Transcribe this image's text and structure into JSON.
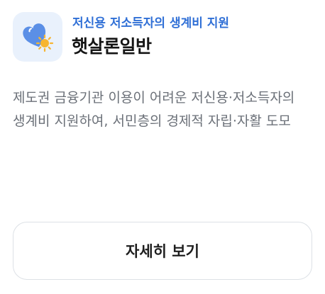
{
  "card": {
    "icon": "heart-with-sun-icon",
    "subtitle": "저신용 저소득자의 생계비 지원",
    "title": "햇살론일반",
    "description": "제도권 금융기관 이용이 어려운 저신용·저소득자의 생계비 지원하여, 서민층의 경제적 자립·자활 도모",
    "button_label": "자세히 보기"
  },
  "colors": {
    "accent": "#2f6fd6",
    "icon_tile_bg": "#e9f1fc",
    "heart": "#5b8fe6",
    "sun": "#f7b531"
  }
}
